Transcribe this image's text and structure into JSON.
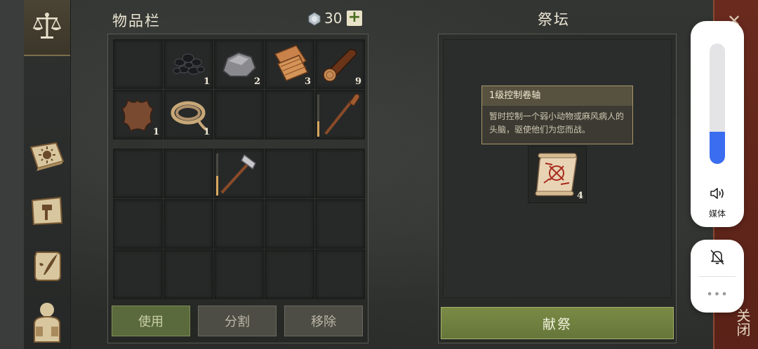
{
  "inventory": {
    "title": "物品栏",
    "currency": {
      "icon": "gem-icon",
      "amount": "30",
      "add_label": "+"
    },
    "slots": [
      {
        "item": "",
        "count": ""
      },
      {
        "item": "coal",
        "count": "1"
      },
      {
        "item": "stone",
        "count": "2"
      },
      {
        "item": "fiber-cloth",
        "count": "3"
      },
      {
        "item": "wood-log",
        "count": "9"
      },
      {
        "item": "leather-hide",
        "count": "1"
      },
      {
        "item": "rope",
        "count": "1"
      },
      {
        "item": "",
        "count": ""
      },
      {
        "item": "",
        "count": ""
      },
      {
        "item": "wooden-paddle",
        "count": ""
      }
    ],
    "equip_slots": [
      {
        "item": "",
        "count": ""
      },
      {
        "item": "",
        "count": ""
      },
      {
        "item": "stone-hammer",
        "count": ""
      },
      {
        "item": "",
        "count": ""
      },
      {
        "item": "",
        "count": ""
      }
    ],
    "buttons": {
      "use": "使用",
      "split": "分割",
      "remove": "移除"
    }
  },
  "altar": {
    "title": "祭坛",
    "tooltip": {
      "name": "1级控制卷轴",
      "description": "暂时控制一个弱小动物或麻风病人的头脑，驱使他们为您而战。"
    },
    "slot": {
      "item": "control-scroll",
      "count": "4"
    },
    "offer_button": "献祭"
  },
  "side_close": {
    "icon": "close-icon",
    "label": "关闭"
  },
  "system_overlay": {
    "volume_label": "媒体",
    "volume_level": 0.27,
    "volume_icon": "speaker-icon",
    "bell_icon": "bell-off-icon",
    "more_icon": "more-dots-icon",
    "more_label": "•••"
  },
  "colors": {
    "accent_green": "#7a8a45",
    "volume_fill": "#3a6df0",
    "tooltip_border": "#a8966a"
  }
}
